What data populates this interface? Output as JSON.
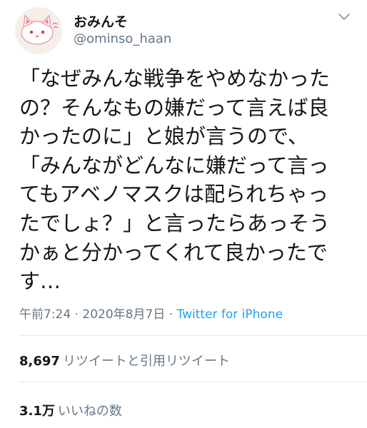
{
  "user": {
    "display_name": "おみんそ",
    "handle": "@ominso_haan",
    "avatar_icon": "white-cat-avatar-icon"
  },
  "tweet": {
    "text": "「なぜみんな戦争をやめなかった\nの？そんなもの嫌だって言えば良\nかったのに」と娘が言うので、\n「みんながどんなに嫌だって言っ\nてもアベノマスクは配られちゃっ\nたでしょ？」と言ったらあっそう\nかぁと分かってくれて良かったで\nす…"
  },
  "meta": {
    "timestamp": "午前7:24 · 2020年8月7日",
    "separator": " · ",
    "source": "Twitter for iPhone"
  },
  "stats": {
    "retweets_count": "8,697",
    "retweets_label": "リツイートと引用リツイート",
    "likes_count": "3.1万",
    "likes_label": "いいねの数"
  },
  "colors": {
    "text": "#14171a",
    "secondary": "#657786",
    "accent": "#1da1f2",
    "divider": "#e1e8ed"
  }
}
